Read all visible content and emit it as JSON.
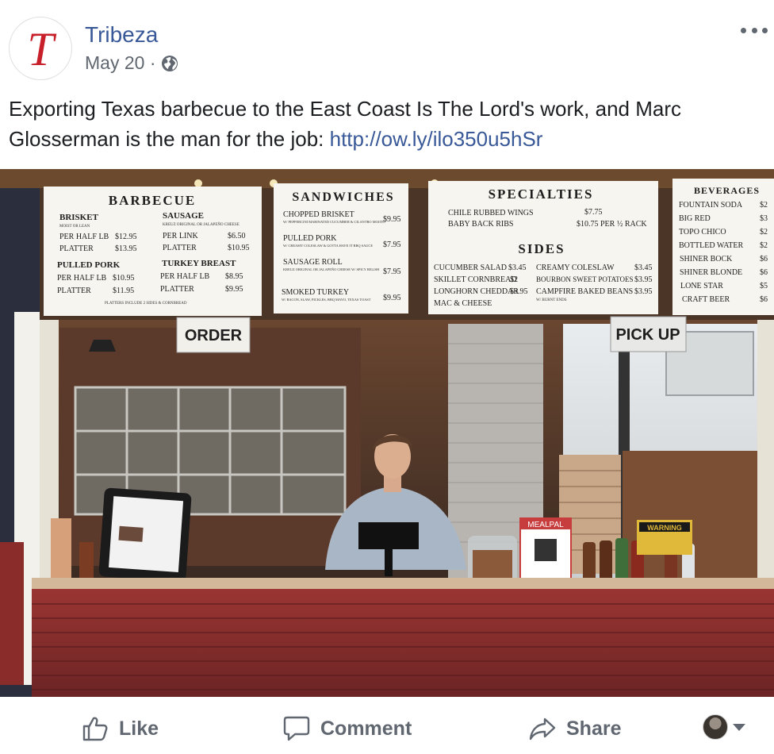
{
  "post": {
    "author": "Tribeza",
    "avatar_letter": "T",
    "date": "May 20 ·",
    "text_before_link": "Exporting Texas barbecue to the East Coast Is The Lord's work, and Marc Glosserman is the man for the job: ",
    "link_text": "http://ow.ly/ilo350u5hSr"
  },
  "icons": {
    "privacy": "globe-icon",
    "more": "more-icon",
    "like": "thumbs-up-icon",
    "comment": "speech-bubble-icon",
    "share": "share-arrow-icon",
    "audience_caret": "caret-down-icon"
  },
  "photo": {
    "menu": {
      "barbecue": {
        "title": "BARBECUE",
        "brisket": "BRISKET",
        "brisket_note": "MOIST OR LEAN",
        "brisket_rows": [
          [
            "PER HALF LB",
            "$12.95"
          ],
          [
            "PLATTER",
            "$13.95"
          ]
        ],
        "pulled_pork": "PULLED PORK",
        "pulled_pork_rows": [
          [
            "PER HALF LB",
            "$10.95"
          ],
          [
            "PLATTER",
            "$11.95"
          ]
        ],
        "sausage": "SAUSAGE",
        "sausage_note": "KREUZ ORIGINAL OR JALAPEÑO CHEESE",
        "sausage_rows": [
          [
            "PER LINK",
            "$6.50"
          ],
          [
            "PLATTER",
            "$10.95"
          ]
        ],
        "turkey": "TURKEY BREAST",
        "turkey_rows": [
          [
            "PER HALF LB",
            "$8.95"
          ],
          [
            "PLATTER",
            "$9.95"
          ]
        ],
        "footer": "PLATTERS INCLUDE 2 SIDES & CORNBREAD"
      },
      "sandwiches": {
        "title": "SANDWICHES",
        "items": [
          [
            "CHOPPED BRISKET",
            "$9.95",
            "W/ PEPPERCINI MARINATED CUCUMBER & CILANTRO MOJITO"
          ],
          [
            "PULLED PORK",
            "$7.95",
            "W/ CREAMY COLESLAW & GOTTA HAVE IT BBQ SAUCE"
          ],
          [
            "SAUSAGE ROLL",
            "$7.95",
            "KREUZ ORIGINAL OR JALAPEÑO CHEESE W/ SPICY RELISH"
          ],
          [
            "SMOKED TURKEY",
            "$9.95",
            "W/ BACON, SLAW, PICKLES, BBQ MAYO, TEXAS TOAST"
          ]
        ]
      },
      "specialties": {
        "title": "SPECIALTIES",
        "items": [
          [
            "CHILE RUBBED WINGS",
            "$7.75"
          ],
          [
            "BABY BACK RIBS",
            "$10.75 PER ½ RACK"
          ]
        ]
      },
      "sides": {
        "title": "SIDES",
        "left": [
          [
            "CUCUMBER SALAD",
            "$3.45"
          ],
          [
            "SKILLET CORNBREAD",
            "$2"
          ],
          [
            "LONGHORN CHEDDAR",
            "$3.95"
          ],
          [
            "MAC & CHEESE",
            ""
          ]
        ],
        "right": [
          [
            "CREAMY COLESLAW",
            "$3.45"
          ],
          [
            "BOURBON SWEET POTATOES",
            "$3.95"
          ],
          [
            "CAMPFIRE BAKED BEANS",
            "$3.95"
          ],
          [
            "W/ BURNT ENDS",
            ""
          ]
        ]
      },
      "beverages": {
        "title": "BEVERAGES",
        "items": [
          [
            "FOUNTAIN SODA",
            "$2"
          ],
          [
            "BIG RED",
            "$3"
          ],
          [
            "TOPO CHICO",
            "$2"
          ],
          [
            "BOTTLED WATER",
            "$2"
          ],
          [
            "SHINER BOCK",
            "$6"
          ],
          [
            "SHINER BLONDE",
            "$6"
          ],
          [
            "LONE STAR",
            "$5"
          ],
          [
            "CRAFT BEER",
            "$6"
          ]
        ]
      }
    },
    "signs": {
      "order": "ORDER",
      "pickup": "PICK UP",
      "mealpal": "MEALPAL",
      "warning": "WARNING"
    }
  },
  "actions": {
    "like": "Like",
    "comment": "Comment",
    "share": "Share"
  },
  "colors": {
    "link": "#385898",
    "secondary_text": "#606770",
    "avatar_red": "#c8202a",
    "counter_red": "#8b2a2c"
  }
}
